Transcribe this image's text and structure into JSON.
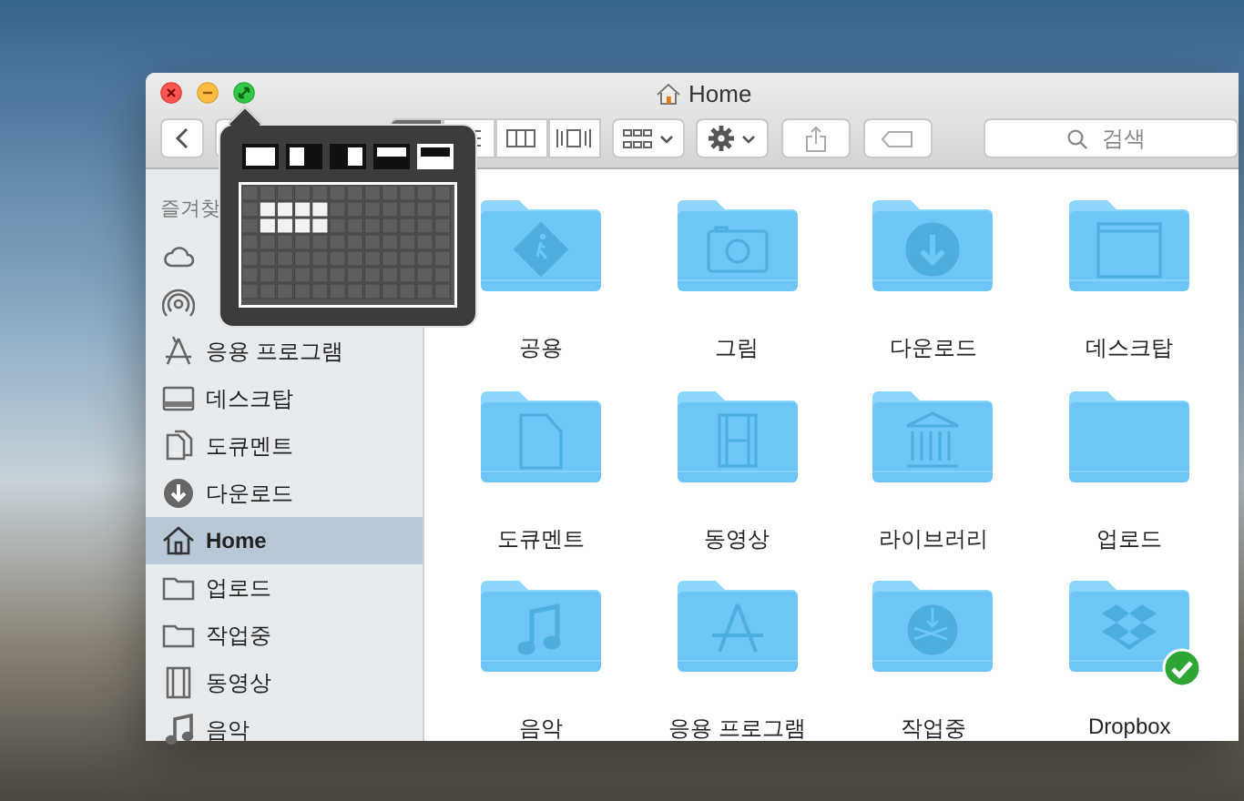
{
  "window": {
    "title": "Home"
  },
  "toolbar": {
    "search": {
      "placeholder": "검색"
    }
  },
  "sidebar": {
    "header": "즐겨찾",
    "items": [
      {
        "kind": "cloud",
        "selected": false
      },
      {
        "kind": "airdrop",
        "selected": false
      },
      {
        "kind": "apps",
        "label": "응용 프로그램",
        "selected": false
      },
      {
        "kind": "desktop",
        "label": "데스크탑",
        "selected": false
      },
      {
        "kind": "document",
        "label": "도큐멘트",
        "selected": false
      },
      {
        "kind": "download",
        "label": "다운로드",
        "selected": false
      },
      {
        "kind": "home",
        "label": "Home",
        "selected": true
      },
      {
        "kind": "folder",
        "label": "업로드",
        "selected": false
      },
      {
        "kind": "folder",
        "label": "작업중",
        "selected": false
      },
      {
        "kind": "film",
        "label": "동영상",
        "selected": false
      },
      {
        "kind": "music",
        "label": "음악",
        "selected": false
      }
    ]
  },
  "files": [
    {
      "kind": "public",
      "name": "공용",
      "synced": false
    },
    {
      "kind": "pictures",
      "name": "그림",
      "synced": false
    },
    {
      "kind": "download",
      "name": "다운로드",
      "synced": false
    },
    {
      "kind": "desktop",
      "name": "데스크탑",
      "synced": false
    },
    {
      "kind": "document",
      "name": "도큐멘트",
      "synced": false
    },
    {
      "kind": "film",
      "name": "동영상",
      "synced": false
    },
    {
      "kind": "library",
      "name": "라이브러리",
      "synced": false
    },
    {
      "kind": "plain",
      "name": "업로드",
      "synced": false
    },
    {
      "kind": "music",
      "name": "음악",
      "synced": false
    },
    {
      "kind": "apps",
      "name": "응용 프로그램",
      "synced": false
    },
    {
      "kind": "work",
      "name": "작업중",
      "synced": false
    },
    {
      "kind": "dropbox",
      "name": "Dropbox",
      "synced": true
    }
  ]
}
